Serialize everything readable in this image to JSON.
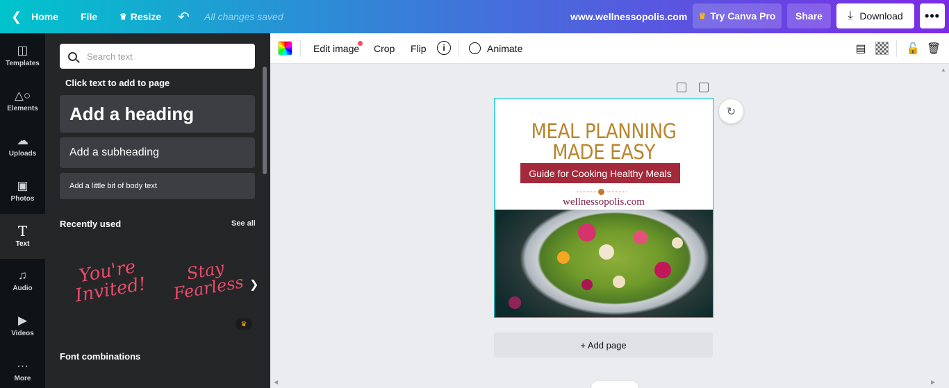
{
  "topbar": {
    "home": "Home",
    "file": "File",
    "resize": "Resize",
    "saved": "All changes saved",
    "site": "www.wellnessopolis.com",
    "try_pro": "Try Canva Pro",
    "share": "Share",
    "download": "Download",
    "more": "•••"
  },
  "rail": {
    "items": [
      {
        "label": "Templates",
        "icon": "templates-icon"
      },
      {
        "label": "Elements",
        "icon": "elements-icon"
      },
      {
        "label": "Uploads",
        "icon": "uploads-icon"
      },
      {
        "label": "Photos",
        "icon": "photos-icon"
      },
      {
        "label": "Text",
        "icon": "text-icon"
      },
      {
        "label": "Audio",
        "icon": "audio-icon"
      },
      {
        "label": "Videos",
        "icon": "videos-icon"
      },
      {
        "label": "More",
        "icon": "more-icon"
      }
    ],
    "active": "Text"
  },
  "panel": {
    "search_placeholder": "Search text",
    "click_to_add": "Click text to add to page",
    "heading": "Add a heading",
    "subheading": "Add a subheading",
    "body": "Add a little bit of body text",
    "recently_used": "Recently used",
    "see_all": "See all",
    "recent": [
      "You're Invited!",
      "Stay Fearless"
    ],
    "font_combinations": "Font combinations"
  },
  "toolbar": {
    "edit_image": "Edit image",
    "crop": "Crop",
    "flip": "Flip",
    "info": "i",
    "animate": "Animate"
  },
  "design": {
    "title": "MEAL PLANNING MADE EASY",
    "title_line1": "MEAL PLANNING",
    "title_line2": "MADE EASY",
    "banner": "Guide for Cooking Healthy Meals",
    "site": "wellnessopolis.com",
    "colors": {
      "title": "#b8862e",
      "banner": "#a3293b",
      "site": "#7a1f4a"
    }
  },
  "canvas": {
    "add_page": "+ Add page"
  },
  "colors": {
    "accent_start": "#00c4cc",
    "accent_end": "#7d2ae8",
    "panel": "#252627",
    "rail": "#0e1318"
  }
}
